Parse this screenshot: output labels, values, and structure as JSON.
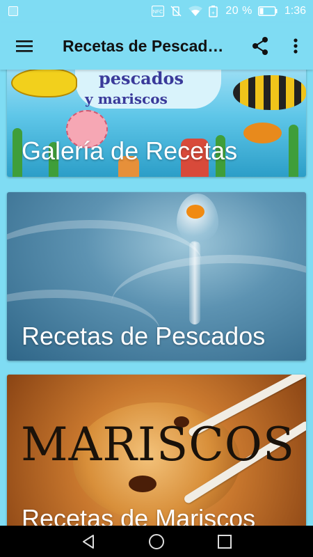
{
  "status_bar": {
    "nfc_label": "NFC",
    "battery_percent": "20 %",
    "time": "1:36"
  },
  "app_bar": {
    "title": "Recetas de Pescados y Mariscos",
    "menu_icon": "hamburger-menu-icon",
    "share_icon": "share-icon",
    "more_icon": "more-vert-icon"
  },
  "cards": [
    {
      "label": "Galería de Recetas",
      "image_text_1": "pescados",
      "image_text_2": "y mariscos"
    },
    {
      "label": "Recetas de Pescados"
    },
    {
      "label": "Recetas de Mariscos",
      "image_text": "MARISCOS"
    }
  ],
  "colors": {
    "primary": "#7fdcf3",
    "nav_bar": "#000000",
    "card_text": "#ffffff"
  }
}
